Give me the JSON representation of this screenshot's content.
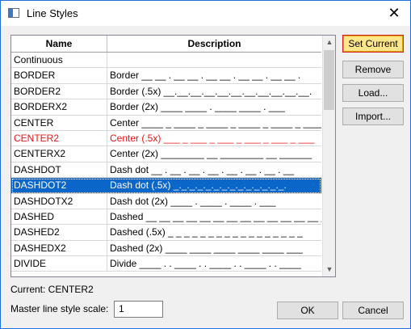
{
  "window": {
    "title": "Line Styles"
  },
  "table": {
    "headers": {
      "name": "Name",
      "description": "Description"
    },
    "rows": [
      {
        "name": "Continuous",
        "description": ""
      },
      {
        "name": "BORDER",
        "description": "Border __ __ . __ __ . __ __ . __ __ . __ __ ."
      },
      {
        "name": "BORDER2",
        "description": "Border (.5x) __.__.__.__.__.__.__.__.__.__.__."
      },
      {
        "name": "BORDERX2",
        "description": "Border (2x) ____ ____ . ____ ____ . ___"
      },
      {
        "name": "CENTER",
        "description": "Center ____ _ ____ _ ____ _ ____ _ ____ _ ____"
      },
      {
        "name": "CENTER2",
        "description": "Center (.5x) ___ _ ___ _ ___ _ ___ _ ___ _ ___"
      },
      {
        "name": "CENTERX2",
        "description": "Center (2x) ________ __ ________ __ ______"
      },
      {
        "name": "DASHDOT",
        "description": "Dash dot __ . __ . __ . __ . __ . __ . __ . __"
      },
      {
        "name": "DASHDOT2",
        "description": "Dash dot (.5x) _._._._._._._._._._._._._._."
      },
      {
        "name": "DASHDOTX2",
        "description": "Dash dot (2x) ____ . ____ . ____ . ___"
      },
      {
        "name": "DASHED",
        "description": "Dashed __ __ __ __ __ __ __ __ __ __ __ __ __ _"
      },
      {
        "name": "DASHED2",
        "description": "Dashed (.5x) _ _ _ _ _ _ _ _ _ _ _ _ _ _ _ _ _"
      },
      {
        "name": "DASHEDX2",
        "description": "Dashed (2x) ____ ____ ____ ____ ____ ___"
      },
      {
        "name": "DIVIDE",
        "description": "Divide ____ . . ____ . . ____ . . ____ . . ____"
      }
    ]
  },
  "buttons": {
    "set_current": "Set Current",
    "remove": "Remove",
    "load": "Load...",
    "import": "Import...",
    "ok": "OK",
    "cancel": "Cancel"
  },
  "current_label": "Current: CENTER2",
  "scale": {
    "label": "Master line style scale:",
    "value": "1"
  },
  "colors": {
    "selection": "#0a66c8",
    "current_style": "#e81414",
    "default_button": "#ffe68a"
  },
  "state": {
    "selected": "DASHDOT2",
    "current": "CENTER2"
  }
}
